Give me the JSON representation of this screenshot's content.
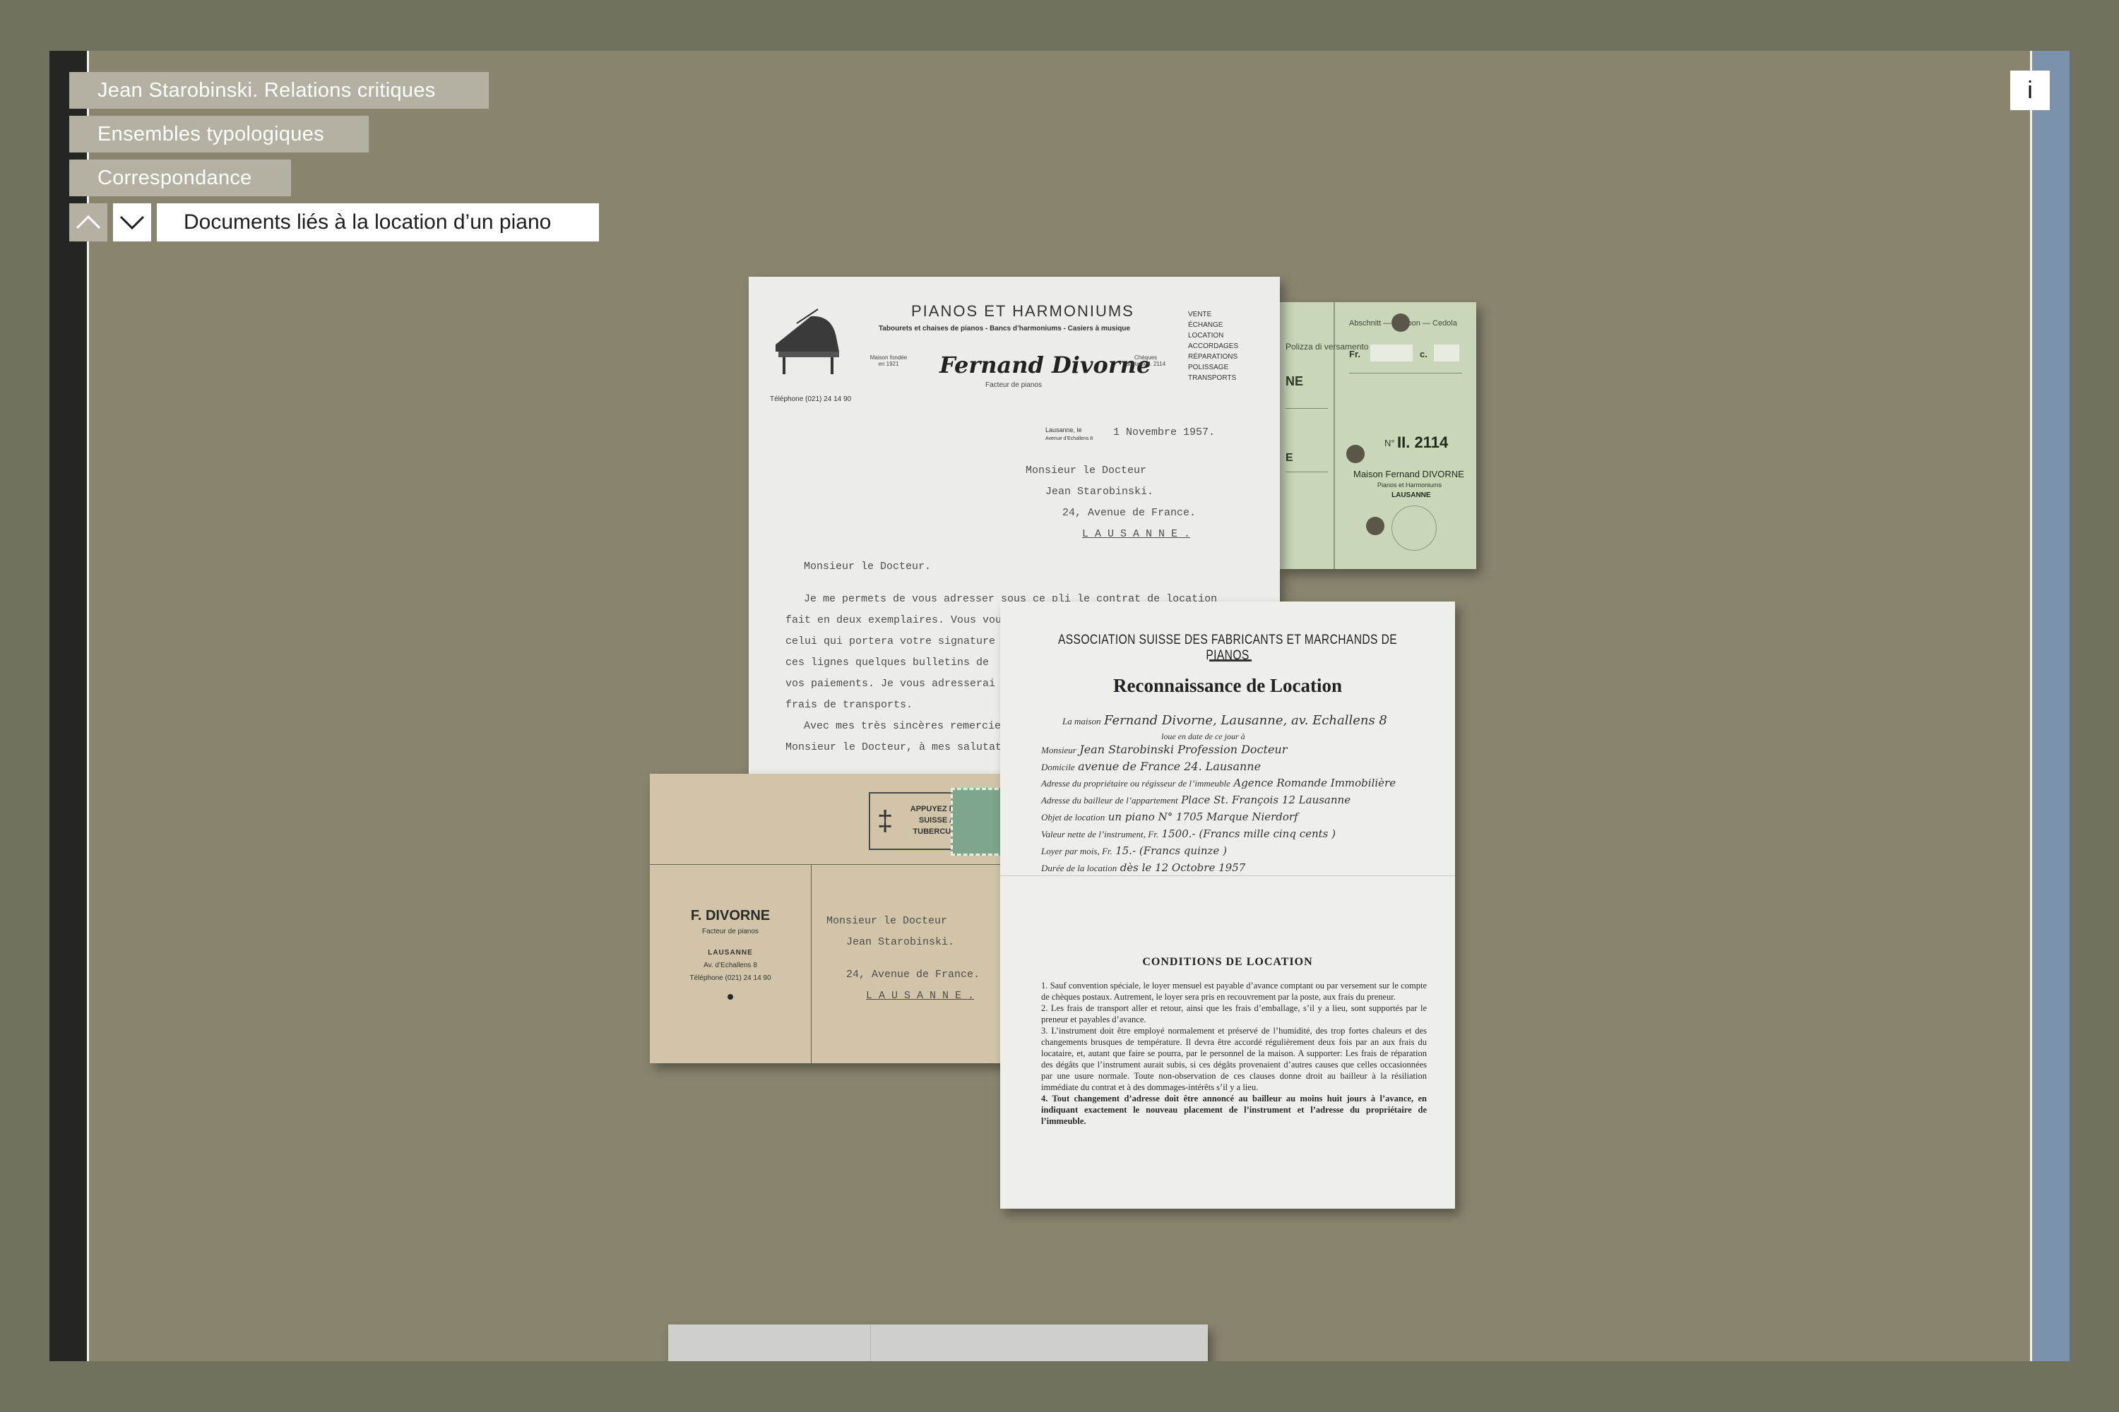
{
  "breadcrumbs": [
    {
      "label": "Jean Starobinski. Relations critiques"
    },
    {
      "label": "Ensembles typologiques"
    },
    {
      "label": "Correspondance"
    }
  ],
  "current_title": "Documents liés à la location d’un piano",
  "info_label": "i",
  "icons": {
    "up": "chevron-up-icon",
    "down": "chevron-down-icon"
  },
  "colors": {
    "background": "#89846e",
    "left_rail": "#252524",
    "right_rail": "#7b93aa",
    "crumb": "#b4b1a3"
  },
  "letter": {
    "heading": "PIANOS ET HARMONIUMS",
    "subheading": "Tabourets et chaises de pianos - Bancs d’harmoniums - Casiers à musique",
    "brand": "Fernand Divorne",
    "brand_sub": "Facteur de pianos",
    "founded": "Maison fondée en 1921",
    "postal": "Chèques postaux II. 2114",
    "phone": "Téléphone (021) 24 14 90",
    "services": [
      "VENTE",
      "ÉCHANGE",
      "LOCATION",
      "ACCORDAGES",
      "RÉPARATIONS",
      "POLISSAGE",
      "TRANSPORTS"
    ],
    "place": "Lausanne, le",
    "place_addr": "Avenue d’Echallens 8",
    "date": "1 Novembre 1957.",
    "addressee": [
      "Monsieur le Docteur",
      "Jean Starobinski.",
      "24, Avenue de France.",
      "L A U S A N N E ."
    ],
    "salutation": "Monsieur le Docteur.",
    "body": [
      "Je me permets de vous adresser sous ce pli le contrat de location",
      "fait en deux exemplaires. Vous vou",
      "celui qui portera votre signature",
      "ces lignes quelques bulletins de",
      "vos paiements. Je vous adresserai",
      "frais de transports.",
      "Avec mes très sincères remercie",
      "Monsieur le Docteur, à mes salutat"
    ]
  },
  "receipt": {
    "header": "Abschnitt — Coupon — Cedola",
    "labels": [
      "Polizza di versamento",
      "Fr.",
      "c.",
      "N°"
    ],
    "number": "II. 2114",
    "payee": "Maison Fernand DIVORNE",
    "payee_sub": "Pianos et Harmoniums",
    "city": "LAUSANNE"
  },
  "envelope": {
    "stamp": "APPUYEZ L’AIDE SUISSE AUX TUBERCULEUX",
    "sender": "F. DIVORNE",
    "sender_sub": "Facteur de pianos",
    "city": "LAUSANNE",
    "addr": "Av. d’Echallens 8",
    "phone": "Téléphone (021) 24 14 90",
    "recipient": [
      "Monsieur le Docteur",
      "Jean Starobinski.",
      "24, Avenue de France.",
      "L A U S A N N E ."
    ]
  },
  "contract": {
    "association": "ASSOCIATION SUISSE DES FABRICANTS ET MARCHANDS DE PIANOS",
    "title": "Reconnaissance de Location",
    "rows": [
      {
        "label": "La maison",
        "value": "Fernand Divorne, Lausanne, av. Echallens 8"
      },
      {
        "label": "loue en date de ce jour à",
        "value": ""
      },
      {
        "label": "Monsieur",
        "value": "Jean Starobinski   Profession  Docteur"
      },
      {
        "label": "Domicile",
        "value": "avenue de France 24. Lausanne"
      },
      {
        "label": "Adresse du propriétaire ou régisseur de l’immeuble",
        "value": "Agence Romande Immobilière"
      },
      {
        "label": "Adresse du bailleur de l’appartement",
        "value": "Place St. François 12 Lausanne"
      },
      {
        "label": "Objet de location",
        "value": "un piano  N° 1705   Marque  Nierdorf"
      },
      {
        "label": "Valeur nette de l’instrument, Fr.",
        "value": "1500.-   (Francs  mille cinq cents )"
      },
      {
        "label": "Loyer par mois, Fr.",
        "value": "15.-   (Francs  quinze )"
      },
      {
        "label": "Durée de la location",
        "value": "dès le 12 Octobre 1957"
      }
    ],
    "conditions_title": "CONDITIONS DE LOCATION",
    "conditions": [
      "1. Sauf convention spéciale, le loyer mensuel est payable d’avance comptant ou par versement sur le compte de chèques postaux. Autrement, le loyer sera pris en recouvrement par la poste, aux frais du preneur.",
      "2. Les frais de transport aller et retour, ainsi que les frais d’emballage, s’il y a lieu, sont supportés par le preneur et payables d’avance.",
      "3. L’instrument doit être employé normalement et préservé de l’humidité, des trop fortes chaleurs et des changements brusques de température. Il devra être accordé régulièrement deux fois par an aux frais du locataire, et, autant que faire se pourra, par le personnel de la maison. A supporter: Les frais de réparation des dégâts que l’instrument aurait subis, si ces dégâts provenaient d’autres causes que celles occasionnées par une usure normale. Toute non-observation de ces clauses donne droit au bailleur à la résiliation immédiate du contrat et à des dommages-intérêts s’il y a lieu.",
      "4. Tout changement d’adresse doit être annoncé au bailleur au moins huit jours à l’avance, en indiquant exactement le nouveau placement de l’instrument et l’adresse du propriétaire de l’immeuble."
    ]
  }
}
